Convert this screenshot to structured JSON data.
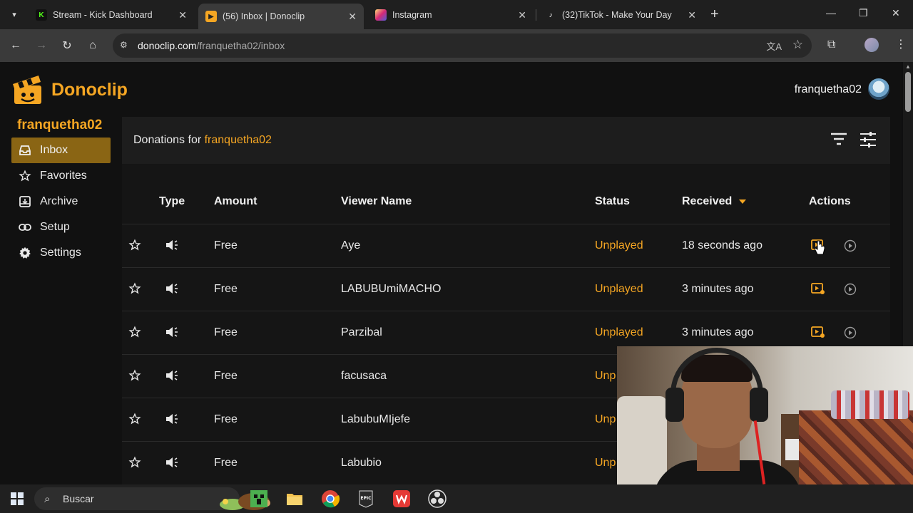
{
  "browser": {
    "tabs": [
      {
        "title": "Stream - Kick Dashboard",
        "favicon": "kick-icon",
        "color": "#53fc18"
      },
      {
        "title": "(56) Inbox | Donoclip",
        "favicon": "donoclip-icon",
        "color": "#f5a623",
        "active": true
      },
      {
        "title": "Instagram",
        "favicon": "instagram-icon",
        "color": "#e1306c"
      },
      {
        "title": "(32)TikTok - Make Your Day",
        "favicon": "tiktok-icon",
        "color": "#ffffff"
      }
    ],
    "url_host": "donoclip.com",
    "url_path": "/franquetha02/inbox"
  },
  "app": {
    "brand": "Donoclip",
    "accent": "#f5a623",
    "username_top": "franquetha02",
    "sidebar_username": "franquetha02",
    "nav": [
      {
        "label": "Inbox",
        "icon": "inbox-icon",
        "active": true
      },
      {
        "label": "Favorites",
        "icon": "star-icon"
      },
      {
        "label": "Archive",
        "icon": "archive-icon"
      },
      {
        "label": "Setup",
        "icon": "link-icon"
      },
      {
        "label": "Settings",
        "icon": "gear-icon"
      }
    ]
  },
  "panel": {
    "title_prefix": "Donations for ",
    "title_user": "franquetha02"
  },
  "table": {
    "headers": {
      "type": "Type",
      "amount": "Amount",
      "viewer": "Viewer Name",
      "status": "Status",
      "received": "Received",
      "actions": "Actions"
    },
    "sort_column": "received",
    "rows": [
      {
        "amount": "Free",
        "viewer": "Aye",
        "status": "Unplayed",
        "received": "18 seconds ago"
      },
      {
        "amount": "Free",
        "viewer": "LABUBUmiMACHO",
        "status": "Unplayed",
        "received": "3 minutes ago"
      },
      {
        "amount": "Free",
        "viewer": "Parzibal",
        "status": "Unplayed",
        "received": "3 minutes ago"
      },
      {
        "amount": "Free",
        "viewer": "facusaca",
        "status": "Unp",
        "received": ""
      },
      {
        "amount": "Free",
        "viewer": "LabubuMIjefe",
        "status": "Unp",
        "received": ""
      },
      {
        "amount": "Free",
        "viewer": "Labubio",
        "status": "Unp",
        "received": ""
      }
    ]
  },
  "taskbar": {
    "search_text": "Buscar",
    "apps": [
      "minecraft-icon",
      "file-explorer-icon",
      "chrome-icon",
      "epic-games-icon",
      "wps-icon",
      "obs-icon"
    ]
  }
}
